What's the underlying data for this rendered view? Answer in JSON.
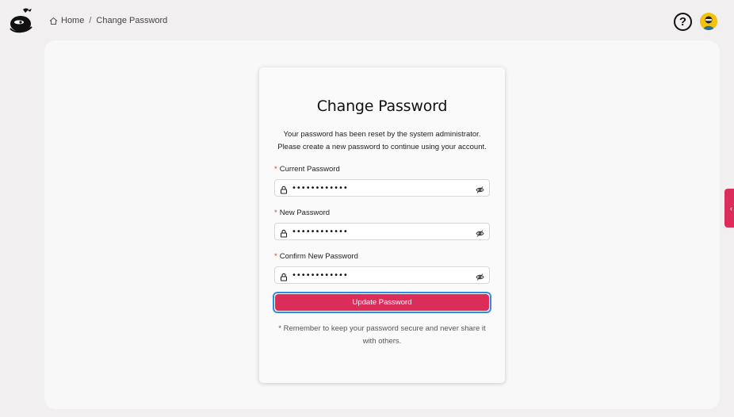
{
  "header": {
    "breadcrumb": {
      "home_label": "Home",
      "separator": "/",
      "current_label": "Change Password"
    },
    "help_label": "?",
    "icons": [
      "logo-icon",
      "home-icon",
      "help-icon",
      "avatar"
    ]
  },
  "card": {
    "title": "Change Password",
    "description_line1": "Your password has been reset by the system administrator.",
    "description_line2": "Please create a new password to continue using your account.",
    "fields": [
      {
        "label": "Current Password",
        "required_mark": "*",
        "value": "••••••••••••"
      },
      {
        "label": "New Password",
        "required_mark": "*",
        "value": "••••••••••••"
      },
      {
        "label": "Confirm New Password",
        "required_mark": "*",
        "value": "••••••••••••"
      }
    ],
    "submit_label": "Update Password",
    "note_line1": "* Remember to keep your password secure and never share it",
    "note_line2": "with others."
  },
  "side_tab": {
    "icon": "chevron-left-icon",
    "glyph": "‹"
  },
  "colors": {
    "accent": "#dc2d5a",
    "focus_outline": "#2f8be6",
    "background": "#f1eff0",
    "required": "#e03a3a"
  }
}
